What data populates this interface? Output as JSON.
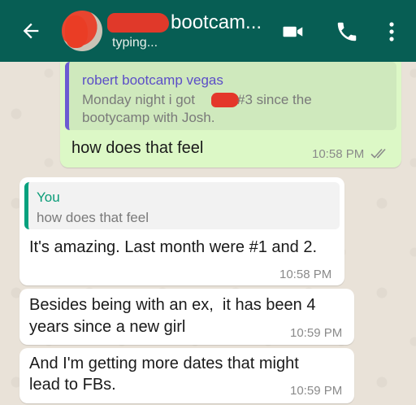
{
  "header": {
    "contact_name": "bootcam...",
    "status": "typing..."
  },
  "messages": [
    {
      "direction": "outgoing",
      "quote": {
        "author": "robert bootcamp vegas",
        "line1_pre": "Monday night i got ",
        "line1_post": "#3 since the",
        "line2": "bootycamp with Josh."
      },
      "text": "how does that feel",
      "time": "10:58 PM",
      "status": "read"
    },
    {
      "direction": "incoming",
      "quote": {
        "author": "You",
        "text": "how does that feel"
      },
      "text": "It's amazing. Last month were #1 and 2.",
      "time": "10:58 PM"
    },
    {
      "direction": "incoming",
      "text_line1": "Besides being with an ex,  it has been 4",
      "text_line2": "years since a new girl",
      "time": "10:59 PM"
    },
    {
      "direction": "incoming",
      "text_line1": "And I'm getting more dates that might",
      "text_line2": "lead to FBs.",
      "time": "10:59 PM"
    }
  ],
  "colors": {
    "header": "#075e54",
    "outgoing_bubble": "#dcf8c6",
    "incoming_bubble": "#ffffff",
    "read_ticks": "#8a8a8a",
    "redaction": "#e4372a"
  },
  "icons": [
    "back-arrow-icon",
    "video-call-icon",
    "phone-icon",
    "more-vert-icon",
    "double-check-icon"
  ]
}
